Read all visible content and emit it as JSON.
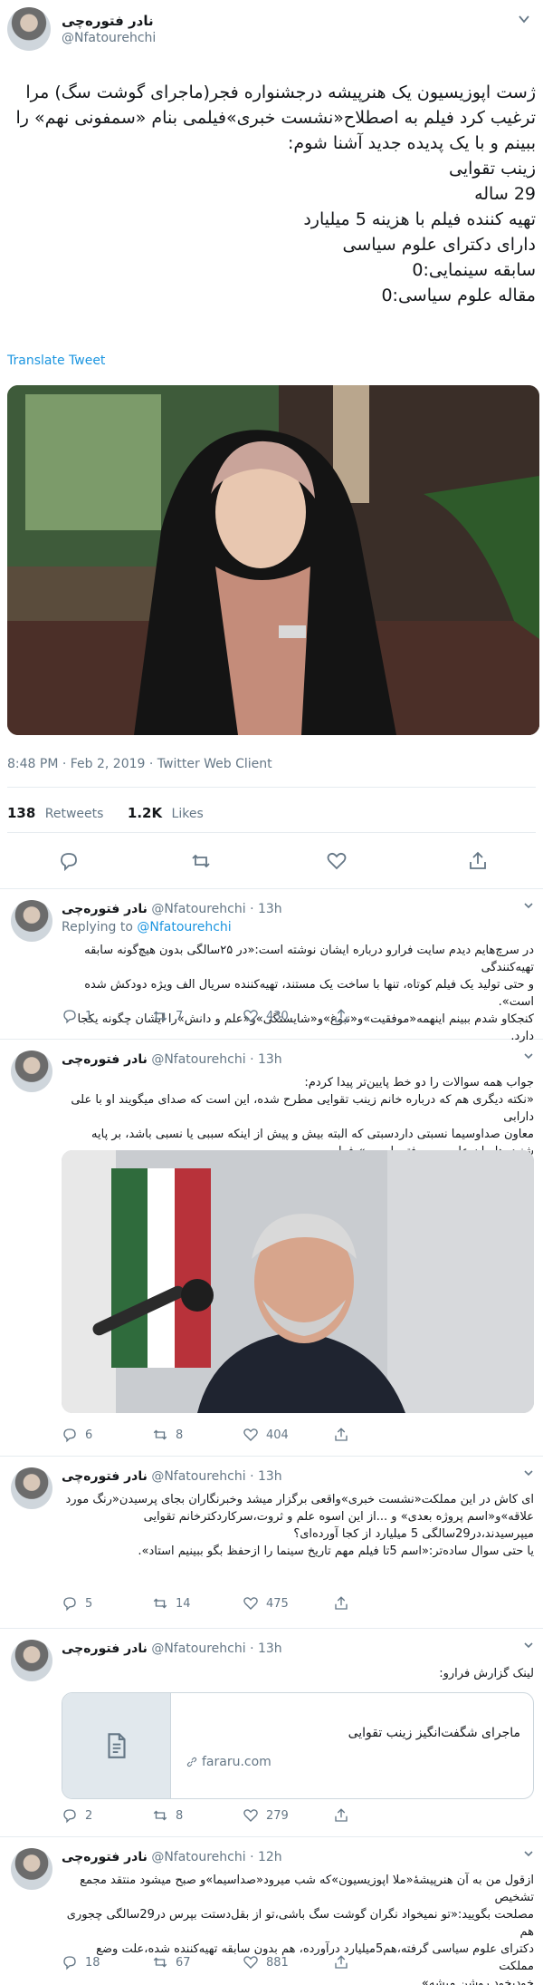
{
  "main_tweet": {
    "name": "نادر فتوره‌چی",
    "handle": "@Nfatourehchi",
    "text_lines": [
      "ژست اپوزیسیون یک هنرپیشه درجشنواره فجر(ماجرای گوشت سگ) مرا",
      "ترغیب کرد فیلم به اصطلاح«نشست خبری»فیلمی بنام «سمفونی نهم» را",
      "ببینم و با یک پدیده جدید آشنا شوم:",
      "زینب تقوایی",
      "29 ساله",
      "تهیه کننده فیلم با هزینه 5 میلیارد",
      "دارای دکترای علوم سیاسی",
      "سابقه سینمایی:0",
      "مقاله علوم سیاسی:0"
    ],
    "translate": "Translate Tweet",
    "meta": "8:48 PM · Feb 2, 2019 · Twitter Web Client",
    "retweets_count": "138",
    "retweets_label": "Retweets",
    "likes_count": "1.2K",
    "likes_label": "Likes"
  },
  "replies": [
    {
      "name": "نادر فتوره‌چی",
      "handle": "@Nfatourehchi",
      "time": "· 13h",
      "replying_prefix": "Replying to",
      "replying_handle": "@Nfatourehchi",
      "text_lines": [
        "در سرچ‌هایم دیدم سایت فرارو درباره ایشان نوشته است:«در ۲۵سالگی بدون هیچ‌گونه سابقه تهیه‌کنندگی",
        "و حتی تولید یک فیلم کوتاه، تنها با ساخت یک مستند، تهیه‌کننده سریال الف ویژه دودکش شده است».",
        "کنجکاو شدم ببینم اینهمه«موفقیت»و«نبوغ»و«شایستگی»و«علم و دانش»را ایشان چگونه یکجا دارد."
      ],
      "replies": "1",
      "retweets": "7",
      "likes": "430"
    },
    {
      "name": "نادر فتوره‌چی",
      "handle": "@Nfatourehchi",
      "time": "· 13h",
      "text_lines": [
        "جواب همه سوالات را دو خط پایین‌تر پیدا کردم:",
        "«نکته دیگری هم که درباره خانم زینب تقوایی مطرح شده، این است که صدای میگویند او با علی دارابی",
        "معاون صداوسیما نسبتی داردسبتی که البته بیش و پیش از اینکه سببی یا نسبی باشد، بر پایه",
        "شنیده‌هایمان علی و معرفتی است.»-فرارو"
      ],
      "replies": "6",
      "retweets": "8",
      "likes": "404"
    },
    {
      "name": "نادر فتوره‌چی",
      "handle": "@Nfatourehchi",
      "time": "· 13h",
      "text_lines": [
        "ای کاش در این مملکت«نشست خبری»واقعی برگزار میشد وخبرنگاران بجای پرسیدن«رنگ مورد",
        "علاقه»و«اسم پروژه بعدی» و ...از این اسوه علم و ثروت،سرکاردکترخانم تقوایی",
        "میپرسیدند،در29سالگی 5 میلیارد از کجا آورده‌ای؟",
        "یا حتی سوال ساده‌تر:«اسم 5تا فیلم مهم تاریخ سینما را ازحفظ بگو ببینیم استاد»."
      ],
      "replies": "5",
      "retweets": "14",
      "likes": "475"
    },
    {
      "name": "نادر فتوره‌چی",
      "handle": "@Nfatourehchi",
      "time": "· 13h",
      "text_lines": [
        "لینک گزارش فرارو:"
      ],
      "card_title": "ماجرای شگفت‌انگیز زینب تقوایی",
      "card_domain": "fararu.com",
      "replies": "2",
      "retweets": "8",
      "likes": "279"
    },
    {
      "name": "نادر فتوره‌چی",
      "handle": "@Nfatourehchi",
      "time": "· 12h",
      "text_lines": [
        "ازقول من به آن هنرپیشهٔ«ملا اپوزیسیون»که شب میرود«صداسیما»و صبح میشود منتقد مجمع تشخیص",
        "مصلحت بگویید:«تو نمیخواد نگران گوشت سگ باشی،تو از بقل‌دستت بپرس در29سالگی چجوری هم",
        "دکترای علوم سیاسی گرفته،هم5میلیارد درآورده، هم بدون سابقه تهیه‌کننده شده،علت وضع مملکت",
        "خودبخود روشن میشه»."
      ],
      "replies": "18",
      "retweets": "67",
      "likes": "881"
    }
  ]
}
